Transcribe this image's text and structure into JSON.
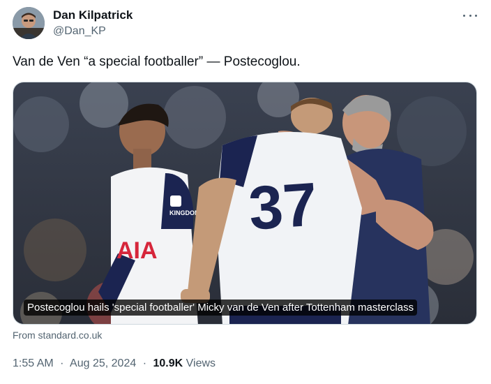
{
  "tweet": {
    "author_name": "Dan Kilpatrick",
    "author_handle": "@Dan_KP",
    "text": "Van de Ven “a special footballer” — Postecoglou.",
    "media_caption": "Postecoglou hails 'special footballer' Micky van de Ven after Tottenham masterclass",
    "source": "From standard.co.uk",
    "time": "1:55 AM",
    "date": "Aug 25, 2024",
    "separator": "·",
    "views_count": "10.9K",
    "views_label": "Views"
  },
  "image": {
    "shirt_number": "37",
    "sponsor_text": "AIA",
    "shirt_brand": "KINGDOM"
  },
  "colors": {
    "text_primary": "#0f1419",
    "text_secondary": "#536471",
    "border": "#cfd9de",
    "navy": "#1b2451"
  },
  "icons": {
    "more": "more-horizontal-icon"
  }
}
